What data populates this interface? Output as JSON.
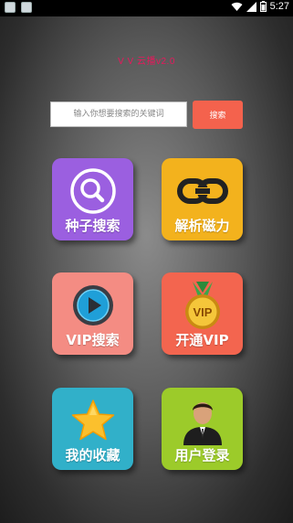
{
  "status_bar": {
    "time": "5:27"
  },
  "app": {
    "title": "V V 云播v2.0"
  },
  "search": {
    "placeholder": "输入你想要搜索的关键词",
    "button_label": "搜索"
  },
  "tiles": [
    {
      "label": "种子搜索",
      "icon": "magnifier-icon",
      "color": "#9b5fe0"
    },
    {
      "label": "解析磁力",
      "icon": "chain-link-icon",
      "color": "#f3b21d"
    },
    {
      "label": "VIP搜索",
      "icon": "play-button-icon",
      "color": "#f48c83"
    },
    {
      "label": "开通VIP",
      "icon": "vip-medal-icon",
      "color": "#f3654f"
    },
    {
      "label": "我的收藏",
      "icon": "star-icon",
      "color": "#31b0c9"
    },
    {
      "label": "用户登录",
      "icon": "user-avatar-icon",
      "color": "#9ccb2a"
    }
  ],
  "vip_medal_text": "VIP"
}
